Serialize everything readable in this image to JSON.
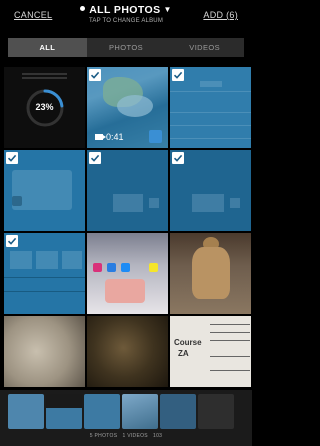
{
  "header": {
    "cancel_label": "CANCEL",
    "album_title": "ALL PHOTOS",
    "album_subtitle": "TAP TO CHANGE ALBUM",
    "add_label": "ADD (6)"
  },
  "tabs": [
    {
      "label": "ALL",
      "active": true
    },
    {
      "label": "PHOTOS",
      "active": false
    },
    {
      "label": "VIDEOS",
      "active": false
    }
  ],
  "grid": {
    "progress_text": "23%",
    "progress_value": 0.23,
    "video_duration": "0:41",
    "selected_count": 6
  },
  "footer": {
    "photos_text": "5 PHOTOS",
    "videos_text": "1 VIDEOS",
    "total_text": "103"
  },
  "colors": {
    "selection_tint": "#006EAA",
    "progress_accent": "#3A8FD4",
    "background": "#000000"
  }
}
